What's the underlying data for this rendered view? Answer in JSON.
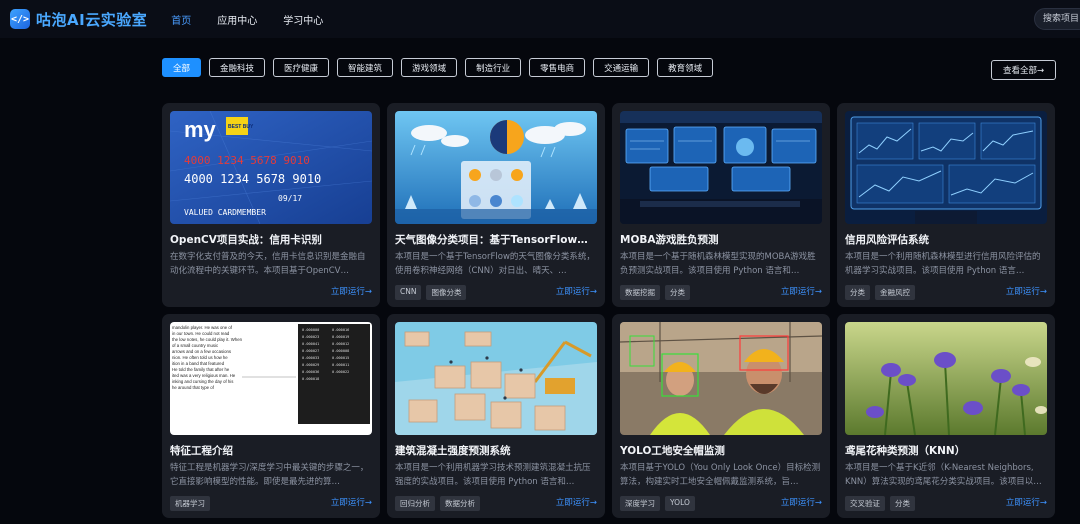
{
  "brand": {
    "logo_mark": "</>",
    "name": "咕泡AI云实验室"
  },
  "nav": [
    {
      "label": "首页",
      "active": true
    },
    {
      "label": "应用中心",
      "active": false
    },
    {
      "label": "学习中心",
      "active": false
    }
  ],
  "search": {
    "placeholder": "搜索项目"
  },
  "filters": [
    {
      "label": "全部",
      "active": true
    },
    {
      "label": "金融科技",
      "active": false
    },
    {
      "label": "医疗健康",
      "active": false
    },
    {
      "label": "智能建筑",
      "active": false
    },
    {
      "label": "游戏领域",
      "active": false
    },
    {
      "label": "制造行业",
      "active": false
    },
    {
      "label": "零售电商",
      "active": false
    },
    {
      "label": "交通运输",
      "active": false
    },
    {
      "label": "教育领域",
      "active": false
    }
  ],
  "view_all": "查看全部→",
  "run_label": "立即运行→",
  "cards": [
    {
      "title": "OpenCV项目实战：信用卡识别",
      "desc": "在数字化支付普及的今天，信用卡信息识别是金融自动化流程中的关键环节。本项目基于OpenCV…",
      "tags": [],
      "image": "credit-card",
      "card_text": {
        "brand": "my",
        "badge": "BEST BUY",
        "number_red": "4000 1234 5678 9010",
        "number": "4000 1234 5678 9010",
        "date": "09/17",
        "holder": "VALUED CARDMEMBER"
      }
    },
    {
      "title": "天气图像分类项目：基于TensorFlow的C…",
      "desc": "本项目是一个基于TensorFlow的天气图像分类系统，使用卷积神经网络（CNN）对日出、晴天、…",
      "tags": [
        "CNN",
        "图像分类"
      ],
      "image": "weather"
    },
    {
      "title": "MOBA游戏胜负预测",
      "desc": "本项目是一个基于随机森林模型实现的MOBA游戏胜负预测实战项目。该项目使用 Python 语言和…",
      "tags": [
        "数据挖掘",
        "分类"
      ],
      "image": "monitors"
    },
    {
      "title": "信用风险评估系统",
      "desc": "本项目是一个利用随机森林模型进行信用风险评估的机器学习实战项目。该项目使用 Python 语言…",
      "tags": [
        "分类",
        "金融风控"
      ],
      "image": "finance-screen"
    },
    {
      "title": "特征工程介绍",
      "desc": "特征工程是机器学习/深度学习中最关键的步骤之一，它直接影响模型的性能。即使是最先进的算…",
      "tags": [
        "机器学习"
      ],
      "image": "text-doc",
      "doc_lines": [
        "mandolin player. He was one of",
        "in our town. He could not read",
        "the low notes, he could play it. When",
        "of a small country music",
        "arrows and on a few occasions",
        "nion. He often told us how he",
        "ition in a band that featured",
        "He told the family that after he",
        "ited was a very religious man. He",
        "inking and cursing the day of his",
        "he around that type of"
      ],
      "num_cells": [
        "0.000000",
        "0.000016",
        "0.000023",
        "0.000019",
        "0.000041",
        "0.000012",
        "0.000027",
        "0.000008",
        "0.000033",
        "0.000015",
        "0.000029",
        "0.000011",
        "0.000036",
        "0.000022",
        "0.000018"
      ]
    },
    {
      "title": "建筑混凝土强度预测系统",
      "desc": "本项目是一个利用机器学习技术预测建筑混凝土抗压强度的实战项目。该项目使用 Python 语言和…",
      "tags": [
        "回归分析",
        "数据分析"
      ],
      "image": "construction"
    },
    {
      "title": "YOLO工地安全帽监测",
      "desc": "本项目基于YOLO（You Only Look Once）目标检测算法，构建实时工地安全帽佩戴监测系统，旨…",
      "tags": [
        "深度学习",
        "YOLO"
      ],
      "image": "helmet"
    },
    {
      "title": "鸢尾花种类预测（KNN）",
      "desc": "本项目是一个基于K近邻（K-Nearest Neighbors, KNN）算法实现的鸢尾花分类实战项目。该项目以…",
      "tags": [
        "交叉验证",
        "分类"
      ],
      "image": "iris"
    }
  ],
  "colors": {
    "accent": "#1e90ff",
    "link": "#3d93ff",
    "card_bg": "#1a1d25",
    "page_bg": "#05070d"
  }
}
